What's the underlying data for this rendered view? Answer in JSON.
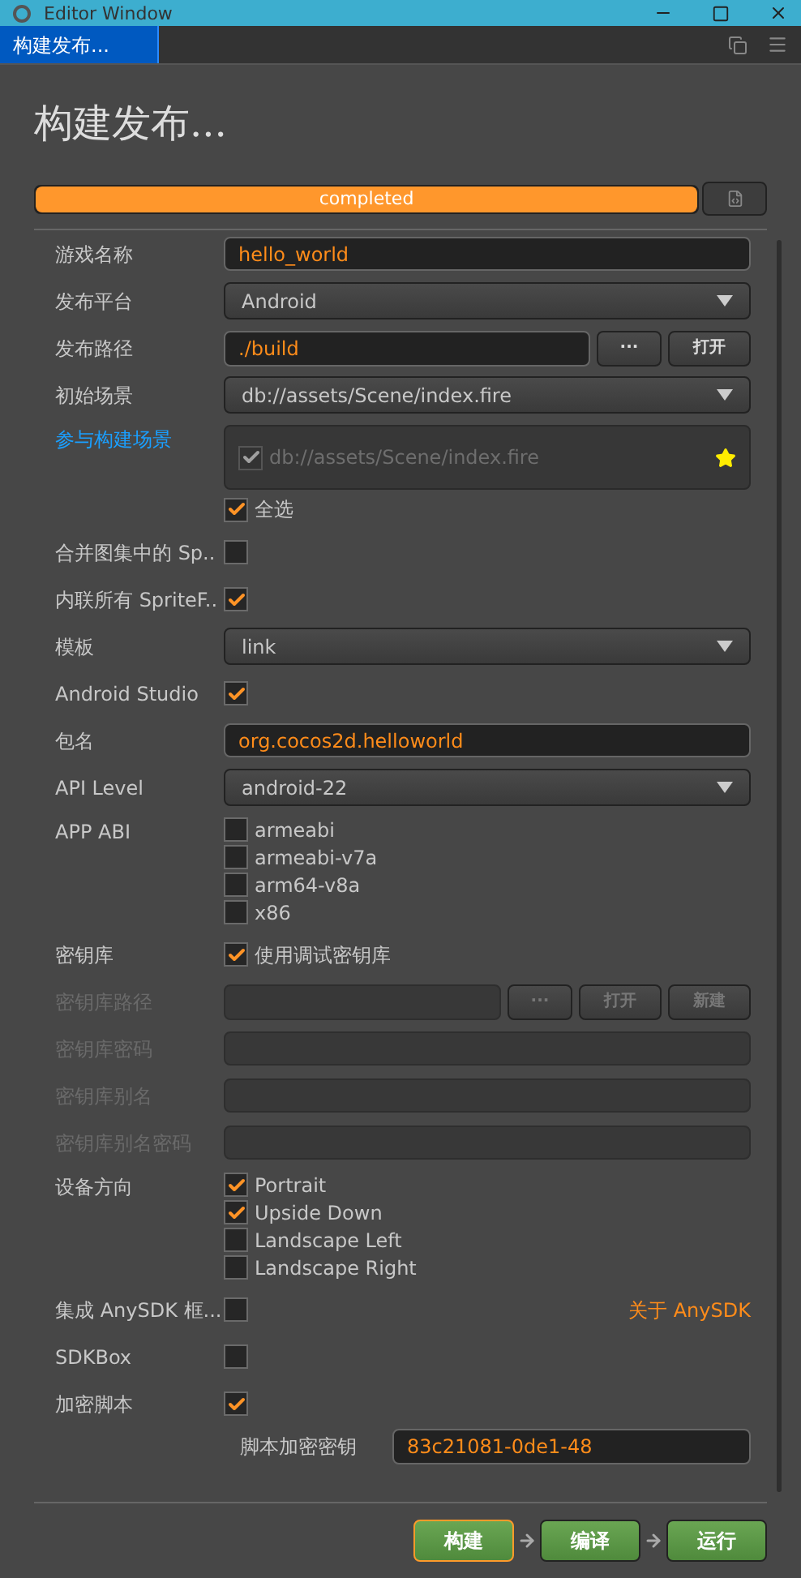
{
  "window": {
    "title": "Editor Window"
  },
  "tabs": [
    {
      "label": "构建发布...",
      "selected": true
    }
  ],
  "heading": "构建发布...",
  "progress": {
    "label": "completed",
    "level": 1
  },
  "fields": [
    {
      "kind": "text",
      "label": "游戏名称",
      "value": "hello_world",
      "disabled": false
    },
    {
      "kind": "select",
      "label": "发布平台",
      "value": "Android"
    },
    {
      "kind": "path",
      "label": "发布路径",
      "value": "./build",
      "buttons": [
        "···",
        "打开"
      ],
      "disabled": false
    },
    {
      "kind": "select",
      "label": "初始场景",
      "value": "db://assets/Scene/index.fire"
    },
    {
      "kind": "scenes",
      "label": "参与构建场景",
      "scenes": [
        {
          "path": "db://assets/Scene/index.fire",
          "checked": true,
          "start": true
        }
      ],
      "select_all": {
        "label": "全选",
        "checked": true
      }
    },
    {
      "kind": "checkbox",
      "label": "合并图集中的 Sp..",
      "checked": false
    },
    {
      "kind": "checkbox",
      "label": "内联所有 SpriteF..",
      "checked": true
    },
    {
      "kind": "select",
      "label": "模板",
      "value": "link"
    },
    {
      "kind": "checkbox",
      "label": "Android Studio",
      "checked": true
    },
    {
      "kind": "text",
      "label": "包名",
      "value": "org.cocos2d.helloworld",
      "disabled": false
    },
    {
      "kind": "select",
      "label": "API Level",
      "value": "android-22"
    },
    {
      "kind": "checklist",
      "label": "APP ABI",
      "options": [
        {
          "label": "armeabi",
          "checked": false
        },
        {
          "label": "armeabi-v7a",
          "checked": false
        },
        {
          "label": "arm64-v8a",
          "checked": false
        },
        {
          "label": "x86",
          "checked": false
        }
      ]
    },
    {
      "kind": "checkbox",
      "label": "密钥库",
      "checked": true,
      "text": "使用调试密钥库"
    },
    {
      "kind": "path",
      "label": "密钥库路径",
      "buttons": [
        "···",
        "打开",
        "新建"
      ],
      "disabled": true
    },
    {
      "kind": "text",
      "label": "密钥库密码",
      "disabled": true
    },
    {
      "kind": "text",
      "label": "密钥库别名",
      "disabled": true
    },
    {
      "kind": "text",
      "label": "密钥库别名密码",
      "disabled": true
    },
    {
      "kind": "checklist",
      "label": "设备方向",
      "options": [
        {
          "label": "Portrait",
          "checked": true
        },
        {
          "label": "Upside Down",
          "checked": true
        },
        {
          "label": "Landscape Left",
          "checked": false
        },
        {
          "label": "Landscape Right",
          "checked": false
        }
      ]
    },
    {
      "kind": "checkbox",
      "label": "集成 AnySDK 框...",
      "checked": false,
      "link": "关于 AnySDK"
    },
    {
      "kind": "checkbox",
      "label": "SDKBox",
      "checked": false
    },
    {
      "kind": "checkbox",
      "label": "加密脚本",
      "checked": true
    },
    {
      "kind": "subtext",
      "label": "脚本加密密钥",
      "value": "83c21081-0de1-48"
    }
  ],
  "actions": [
    {
      "label": "构建",
      "focused": true
    },
    {
      "label": "编译",
      "focused": false
    },
    {
      "label": "运行",
      "focused": false
    }
  ]
}
